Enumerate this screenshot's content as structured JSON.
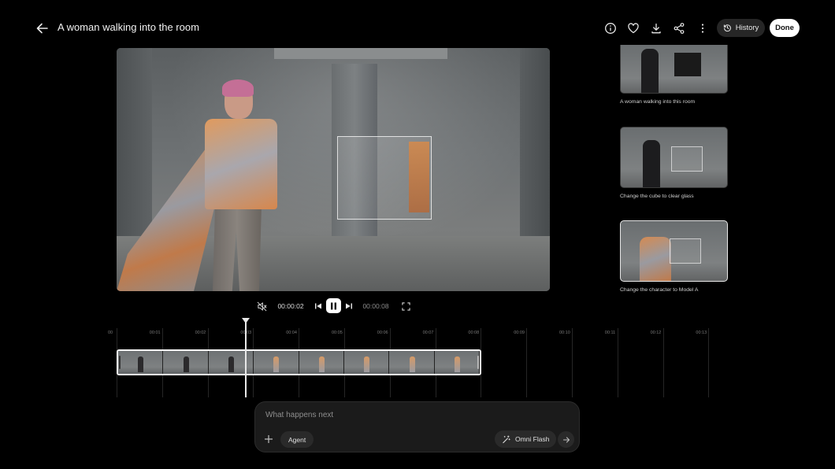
{
  "header": {
    "title": "A woman walking into the room",
    "history_label": "History",
    "done_label": "Done"
  },
  "history": {
    "items": [
      {
        "label": "A woman walking into this room",
        "selected": false
      },
      {
        "label": "Change the cube to clear glass",
        "selected": false
      },
      {
        "label": "Change the character to Model A",
        "selected": true
      }
    ]
  },
  "player": {
    "current_time": "00:00:02",
    "total_time": "00:00:08",
    "muted": true,
    "playing": true
  },
  "timeline": {
    "ticks": [
      "00",
      "00:01",
      "00:02",
      "00:03",
      "00:04",
      "00:05",
      "00:06",
      "00:07",
      "00:08",
      "00:09",
      "00:10",
      "00:11",
      "00:12",
      "00:13"
    ],
    "frame_count": 8
  },
  "prompt": {
    "placeholder": "What happens next",
    "agent_label": "Agent",
    "model_label": "Omni Flash"
  },
  "colors": {
    "background": "#000000",
    "surface": "#1b1b1b",
    "accent": "#ffffff"
  }
}
